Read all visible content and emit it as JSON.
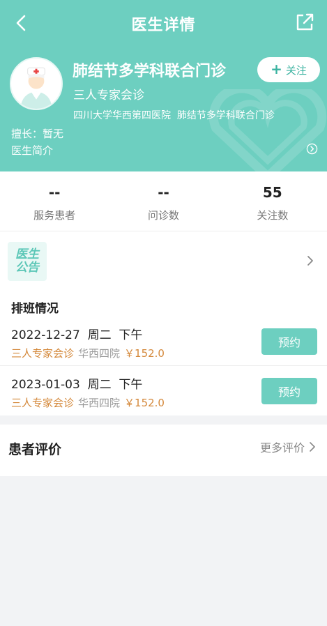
{
  "header": {
    "title": "医生详情",
    "background_color": "#6dcfc0",
    "back_icon": "chevron-left-icon",
    "share_icon": "share-external-icon"
  },
  "doctor": {
    "name": "肺结节多学科联合门诊",
    "title": "三人专家会诊",
    "hospital": "四川大学华西第四医院",
    "department": "肺结节多学科联合门诊",
    "expertise": "擅长：暂无",
    "intro_label": "医生简介",
    "follow_label": "关注"
  },
  "stats": [
    {
      "value": "--",
      "label": "服务患者"
    },
    {
      "value": "--",
      "label": "问诊数"
    },
    {
      "value": "55",
      "label": "关注数"
    }
  ],
  "notice": {
    "line1": "医生",
    "line2": "公告"
  },
  "schedule": {
    "heading": "排班情况",
    "slots": [
      {
        "date": "2022-12-27",
        "weekday": "周二",
        "period": "下午",
        "type": "三人专家会诊",
        "hospital": "华西四院",
        "price": "￥152.0",
        "button": "预约"
      },
      {
        "date": "2023-01-03",
        "weekday": "周二",
        "period": "下午",
        "type": "三人专家会诊",
        "hospital": "华西四院",
        "price": "￥152.0",
        "button": "预约"
      }
    ]
  },
  "reviews": {
    "heading": "患者评价",
    "more_label": "更多评价"
  }
}
